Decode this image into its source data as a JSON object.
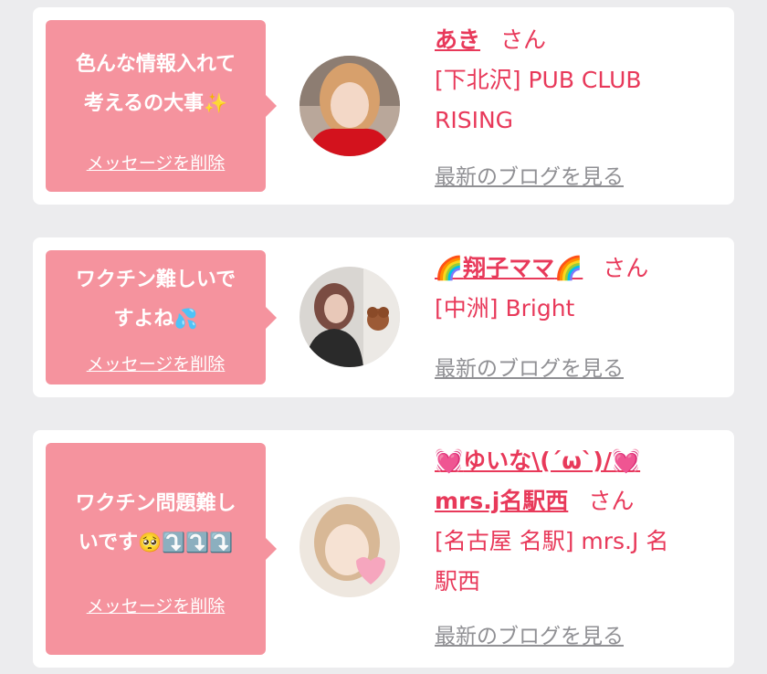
{
  "messages": [
    {
      "message_line1": "色んな情報入れて",
      "message_line2": "考えるの大事",
      "message_emoji": "✨",
      "delete_label": "メッセージを削除",
      "name": "あき",
      "honorific": "さん",
      "shop_line1": "[下北沢] PUB CLUB",
      "shop_line2": "RISING",
      "blog_link": "最新のブログを見る"
    },
    {
      "message_line1": "ワクチン難しいで",
      "message_line2": "すよね",
      "message_emoji": "💦",
      "delete_label": "メッセージを削除",
      "name": "翔子ママ",
      "name_emoji": "🌈",
      "honorific": "さん",
      "shop_line1": "[中洲] Bright",
      "blog_link": "最新のブログを見る"
    },
    {
      "message_line1": "ワクチン問題難し",
      "message_line2": "いです",
      "message_emoji": "🥺⤵️⤵️⤵️",
      "delete_label": "メッセージを削除",
      "name_line1": "ゆいな\\(´ω`)/",
      "name_emoji": "💓",
      "name_line2": "mrs.j名駅西",
      "honorific": "さん",
      "shop_line1": "[名古屋 名駅] mrs.J 名",
      "shop_line2": "駅西",
      "blog_link": "最新のブログを見る"
    }
  ],
  "colors": {
    "bubble": "#f5939e",
    "accent": "#e8395a",
    "link_gray": "#909094",
    "background": "#ececee"
  }
}
